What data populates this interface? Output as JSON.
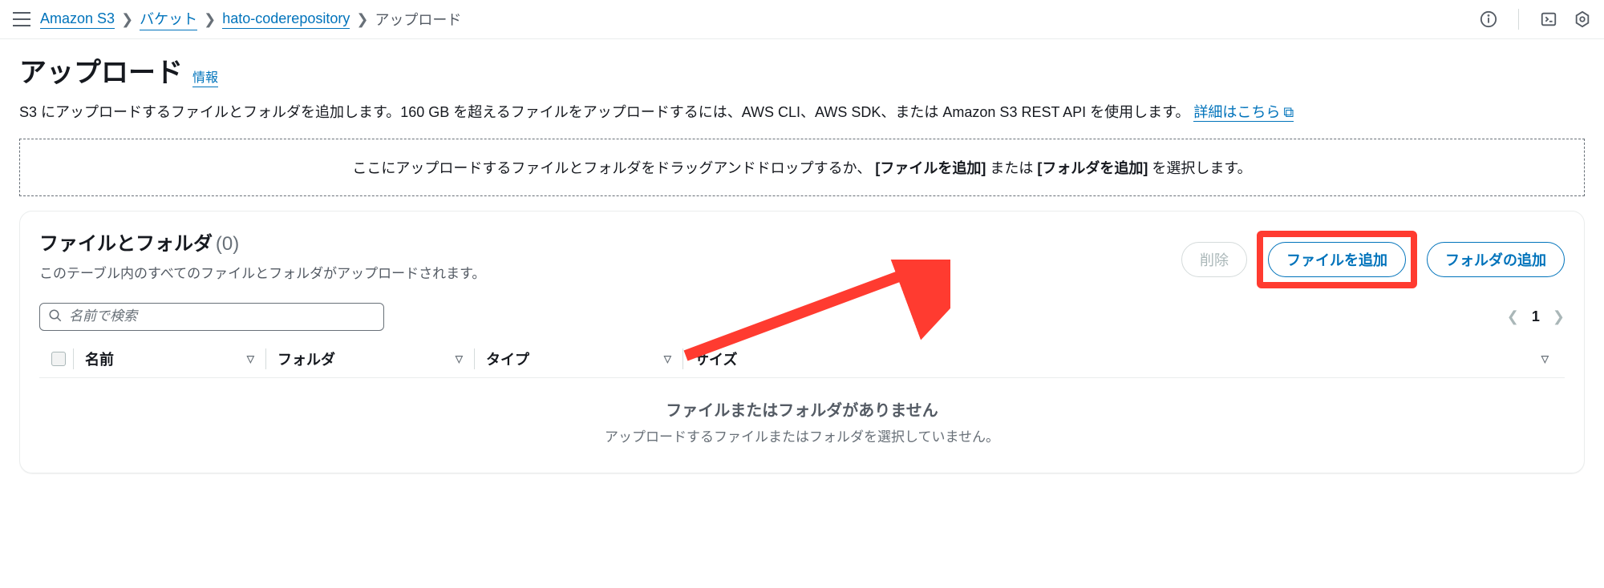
{
  "breadcrumb": {
    "service": "Amazon S3",
    "buckets": "バケット",
    "bucket_name": "hato-coderepository",
    "current": "アップロード"
  },
  "page": {
    "title": "アップロード",
    "info_label": "情報",
    "description_pre": "S3 にアップロードするファイルとフォルダを追加します。160 GB を超えるファイルをアップロードするには、AWS CLI、AWS SDK、または Amazon S3 REST API を使用します。",
    "learn_more": "詳細はこちら"
  },
  "dropzone": {
    "text_prefix": "ここにアップロードするファイルとフォルダをドラッグアンドドロップするか、",
    "bold1": "[ファイルを追加]",
    "mid": " または ",
    "bold2": "[フォルダを追加]",
    "text_suffix": " を選択します。"
  },
  "panel": {
    "title": "ファイルとフォルダ",
    "count": "(0)",
    "subtitle": "このテーブル内のすべてのファイルとフォルダがアップロードされます。",
    "delete_btn": "削除",
    "add_file_btn": "ファイルを追加",
    "add_folder_btn": "フォルダの追加",
    "search_placeholder": "名前で検索",
    "page_number": "1"
  },
  "table": {
    "col_name": "名前",
    "col_folder": "フォルダ",
    "col_type": "タイプ",
    "col_size": "サイズ",
    "empty_title": "ファイルまたはフォルダがありません",
    "empty_sub": "アップロードするファイルまたはフォルダを選択していません。"
  }
}
